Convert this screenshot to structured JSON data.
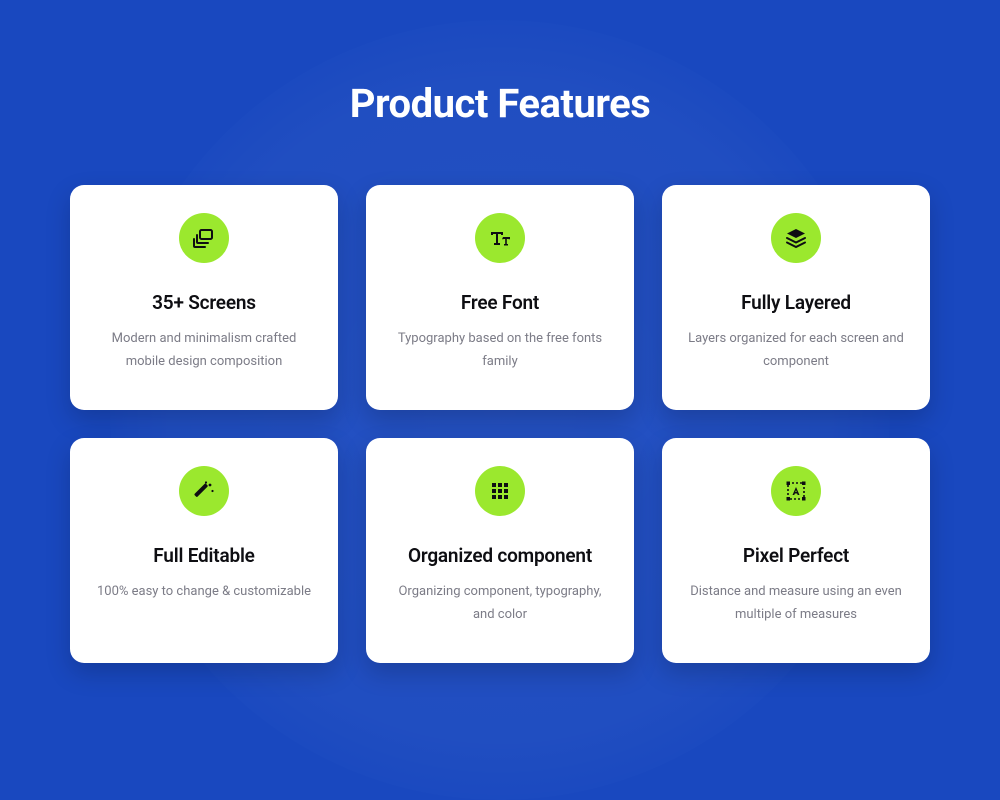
{
  "page": {
    "title": "Product Features"
  },
  "colors": {
    "background": "#1948bf",
    "icon_badge": "#9be82e",
    "card_bg": "#ffffff"
  },
  "features": [
    {
      "icon": "screens-icon",
      "title": "35+ Screens",
      "desc": "Modern and minimalism crafted mobile design composition"
    },
    {
      "icon": "font-icon",
      "title": "Free Font",
      "desc": "Typography based on the free fonts family"
    },
    {
      "icon": "layers-icon",
      "title": "Fully Layered",
      "desc": "Layers organized for each screen and component"
    },
    {
      "icon": "wand-icon",
      "title": "Full Editable",
      "desc": "100% easy to change & customizable"
    },
    {
      "icon": "grid-icon",
      "title": "Organized component",
      "desc": "Organizing component, typography, and color"
    },
    {
      "icon": "pixel-icon",
      "title": "Pixel Perfect",
      "desc": "Distance and measure using an even multiple of measures"
    }
  ]
}
